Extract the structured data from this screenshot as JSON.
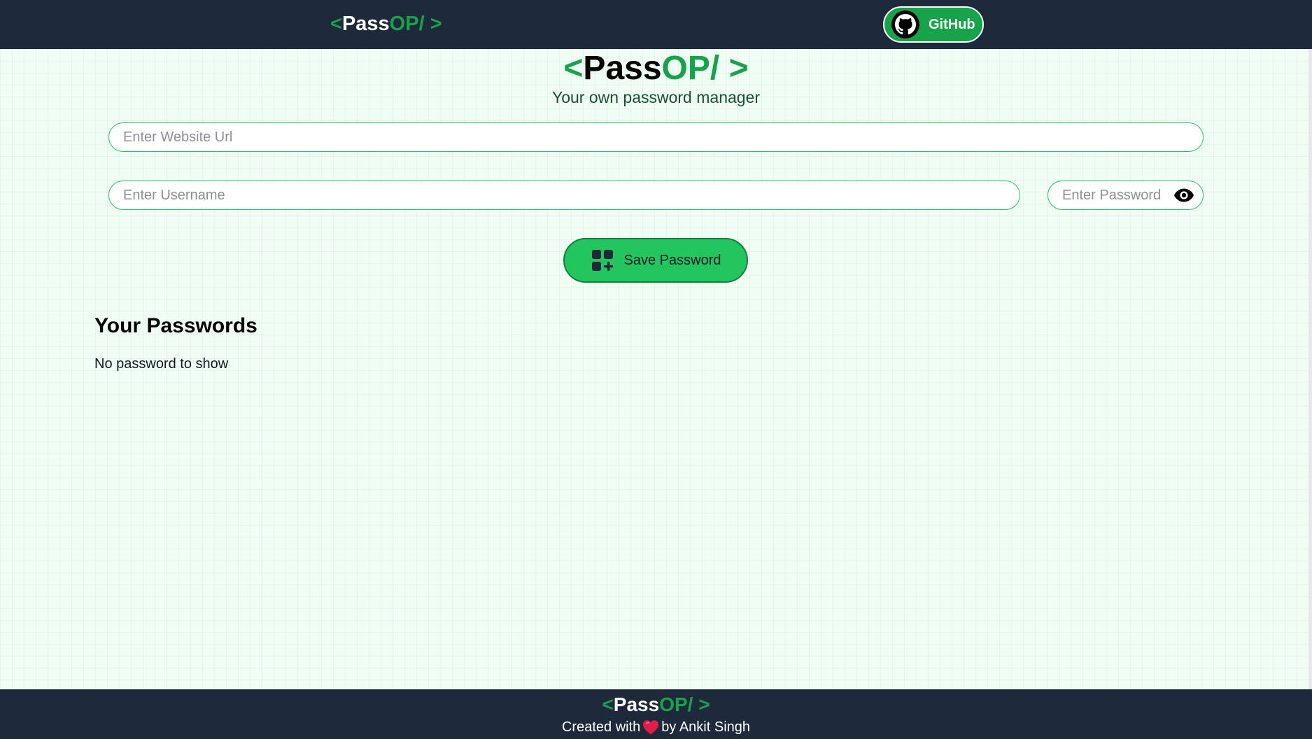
{
  "navbar": {
    "logo": {
      "open_bracket": "<",
      "pass": "Pass",
      "op": "OP/",
      "close_bracket": ">"
    },
    "github_label": "GitHub"
  },
  "hero": {
    "logo": {
      "open_bracket": "<",
      "pass": "Pass",
      "op": "OP/",
      "close_bracket": ">"
    },
    "subtitle": "Your own password manager"
  },
  "form": {
    "website_placeholder": "Enter Website Url",
    "username_placeholder": "Enter Username",
    "password_placeholder": "Enter Password",
    "save_label": "Save Password"
  },
  "passwords": {
    "title": "Your Passwords",
    "empty_message": "No password to show"
  },
  "footer": {
    "logo": {
      "open_bracket": "<",
      "pass": "Pass",
      "op": "OP/",
      "close_bracket": ">"
    },
    "credit_prefix": "Created with",
    "credit_suffix": "by Ankit Singh"
  },
  "icons": {
    "github": "github-icon",
    "eye": "eye-icon",
    "save": "add-grid-icon",
    "heart": "heart-icon"
  },
  "colors": {
    "nav_bg": "#1e293b",
    "accent_green": "#16a34a",
    "button_green": "#22c55e",
    "page_bg": "#f0fdf4"
  }
}
